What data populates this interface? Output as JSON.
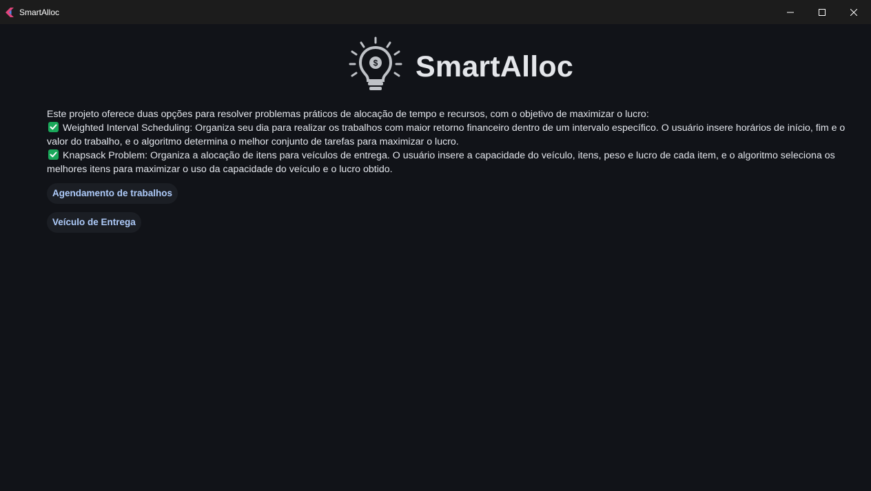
{
  "window": {
    "title": "SmartAlloc",
    "controls": [
      "minimize-icon",
      "maximize-icon",
      "close-icon"
    ]
  },
  "header": {
    "logo_icon": "lightbulb-dollar-icon",
    "title": "SmartAlloc"
  },
  "intro": {
    "text": "Este projeto oferece duas opções para resolver problemas práticos de alocação de tempo e recursos, com o objetivo de maximizar o lucro:",
    "items": [
      {
        "icon": "check-box-icon",
        "text": "Weighted Interval Scheduling: Organiza seu dia para realizar os trabalhos com maior retorno financeiro dentro de um intervalo específico. O usuário insere horários de início, fim e o valor do trabalho, e o algoritmo determina o melhor conjunto de tarefas para maximizar o lucro."
      },
      {
        "icon": "check-box-icon",
        "text": "Knapsack Problem: Organiza a alocação de itens para veículos de entrega. O usuário insere a capacidade do veículo, itens, peso e lucro de cada item, e o algoritmo seleciona os melhores itens para maximizar o uso da capacidade do veículo e o lucro obtido."
      }
    ]
  },
  "buttons": {
    "scheduling_label": "Agendamento de trabalhos",
    "delivery_label": "Veículo de Entrega"
  },
  "colors": {
    "background": "#111318",
    "titlebar": "#1c1c1c",
    "button_text": "#aecbfa",
    "button_bg": "#1b1e24",
    "check_green": "#1aa85a"
  }
}
